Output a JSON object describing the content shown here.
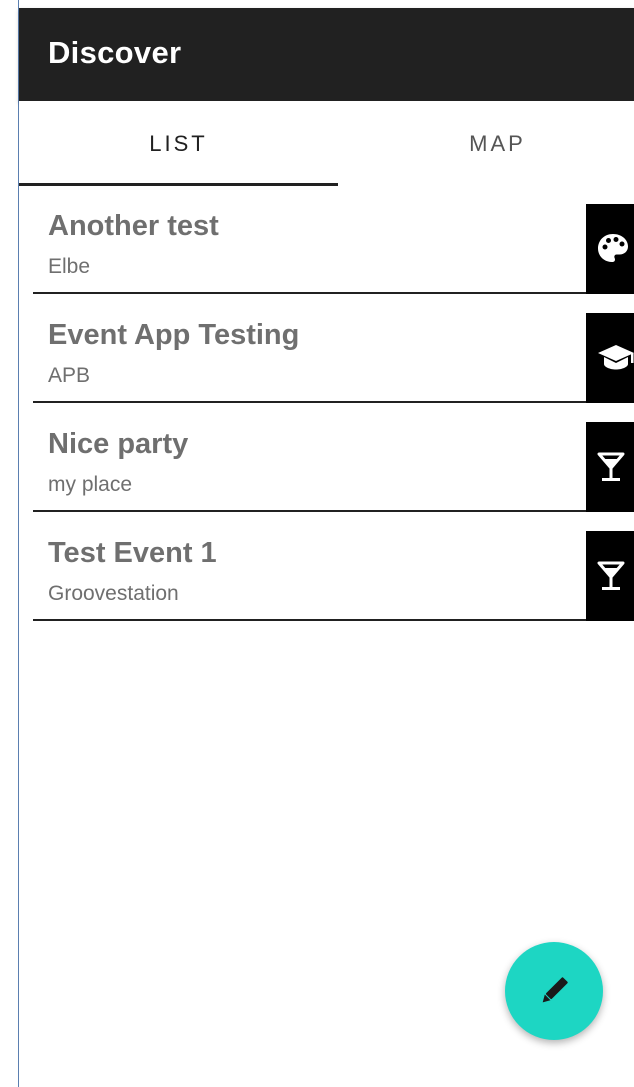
{
  "appbar": {
    "title": "Discover"
  },
  "tabs": [
    {
      "label": "LIST",
      "selected": true
    },
    {
      "label": "MAP",
      "selected": false
    }
  ],
  "events": [
    {
      "title": "Another test",
      "location": "Elbe",
      "category_icon": "palette-icon"
    },
    {
      "title": "Event App Testing",
      "location": "APB",
      "category_icon": "graduation-cap-icon"
    },
    {
      "title": "Nice party",
      "location": "my place",
      "category_icon": "cocktail-glass-icon"
    },
    {
      "title": "Test Event 1",
      "location": "Groovestation",
      "category_icon": "cocktail-glass-icon"
    }
  ],
  "fab": {
    "icon": "pencil-icon"
  },
  "colors": {
    "appbar_bg": "#212121",
    "fab_bg": "#1dd6c3",
    "text_secondary": "#6f6f6f"
  }
}
